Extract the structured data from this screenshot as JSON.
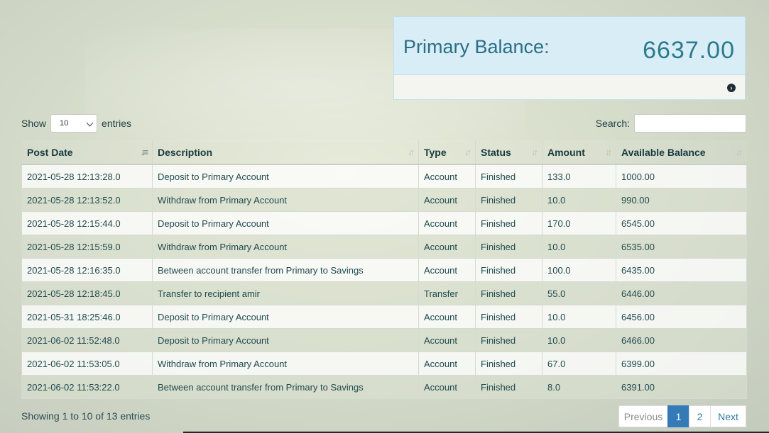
{
  "balance": {
    "label": "Primary Balance:",
    "value": "6637.00"
  },
  "controls": {
    "show_label": "Show",
    "entries_label": "entries",
    "page_size": "10",
    "search_label": "Search:",
    "search_value": ""
  },
  "table": {
    "headers": [
      "Post Date",
      "Description",
      "Type",
      "Status",
      "Amount",
      "Available Balance"
    ],
    "rows": [
      [
        "2021-05-28 12:13:28.0",
        "Deposit to Primary Account",
        "Account",
        "Finished",
        "133.0",
        "1000.00"
      ],
      [
        "2021-05-28 12:13:52.0",
        "Withdraw from Primary Account",
        "Account",
        "Finished",
        "10.0",
        "990.00"
      ],
      [
        "2021-05-28 12:15:44.0",
        "Deposit to Primary Account",
        "Account",
        "Finished",
        "170.0",
        "6545.00"
      ],
      [
        "2021-05-28 12:15:59.0",
        "Withdraw from Primary Account",
        "Account",
        "Finished",
        "10.0",
        "6535.00"
      ],
      [
        "2021-05-28 12:16:35.0",
        "Between account transfer from Primary to Savings",
        "Account",
        "Finished",
        "100.0",
        "6435.00"
      ],
      [
        "2021-05-28 12:18:45.0",
        "Transfer to recipient amir",
        "Transfer",
        "Finished",
        "55.0",
        "6446.00"
      ],
      [
        "2021-05-31 18:25:46.0",
        "Deposit to Primary Account",
        "Account",
        "Finished",
        "10.0",
        "6456.00"
      ],
      [
        "2021-06-02 11:52:48.0",
        "Deposit to Primary Account",
        "Account",
        "Finished",
        "10.0",
        "6466.00"
      ],
      [
        "2021-06-02 11:53:05.0",
        "Withdraw from Primary Account",
        "Account",
        "Finished",
        "67.0",
        "6399.00"
      ],
      [
        "2021-06-02 11:53:22.0",
        "Between account transfer from Primary to Savings",
        "Account",
        "Finished",
        "8.0",
        "6391.00"
      ]
    ]
  },
  "footer": {
    "info": "Showing 1 to 10 of 13 entries",
    "previous": "Previous",
    "pages": [
      "1",
      "2"
    ],
    "next": "Next",
    "current_page": "1"
  },
  "colors": {
    "accent": "#337ab7",
    "panel_heading": "#d8edf5",
    "balance_text": "#2a7b8e"
  },
  "icons": {
    "panel_footer": "arrow-circle-right-icon",
    "sort": "sort-icon",
    "sort_active": "sort-amount-asc-icon"
  }
}
